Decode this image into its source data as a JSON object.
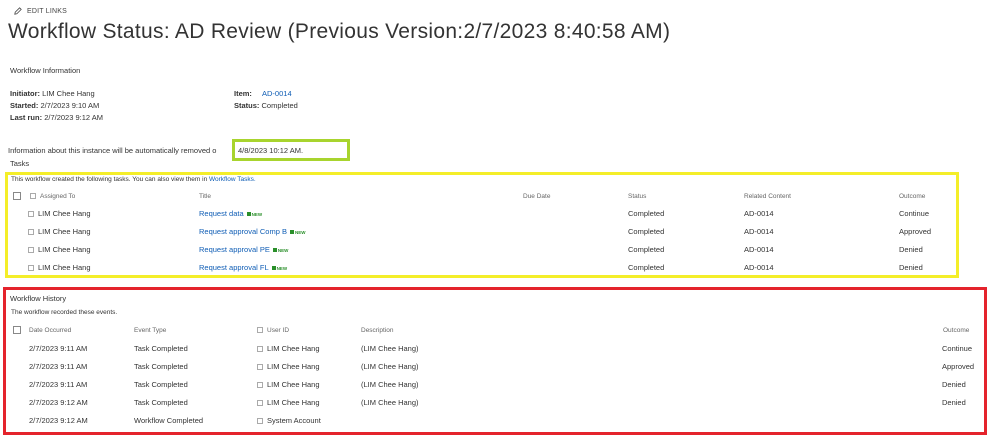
{
  "header": {
    "edit_links_label": "EDIT LINKS",
    "title": "Workflow Status: AD Review (Previous Version:2/7/2023 8:40:58 AM)"
  },
  "workflow_info": {
    "section_label": "Workflow Information",
    "initiator_label": "Initiator:",
    "initiator_value": "LIM Chee Hang",
    "started_label": "Started:",
    "started_value": "2/7/2023 9:10 AM",
    "last_run_label": "Last run:",
    "last_run_value": "2/7/2023 9:12 AM",
    "item_label": "Item:",
    "item_value": "AD-0014",
    "status_label": "Status:",
    "status_value": "Completed"
  },
  "notice": {
    "text": "Information about this instance will be automatically removed o",
    "date": "4/8/2023 10:12 AM."
  },
  "tasks": {
    "section_label": "Tasks",
    "intro": "This workflow created the following tasks. You can also view them in",
    "intro_link": "Workflow Tasks.",
    "columns": [
      "Assigned To",
      "Title",
      "Due Date",
      "Status",
      "Related Content",
      "Outcome"
    ],
    "rows": [
      {
        "assigned_to": "LIM Chee Hang",
        "title": "Request data",
        "due_date": "",
        "status": "Completed",
        "related": "AD-0014",
        "outcome": "Continue"
      },
      {
        "assigned_to": "LIM Chee Hang",
        "title": "Request approval Comp B",
        "due_date": "",
        "status": "Completed",
        "related": "AD-0014",
        "outcome": "Approved"
      },
      {
        "assigned_to": "LIM Chee Hang",
        "title": "Request approval PE",
        "due_date": "",
        "status": "Completed",
        "related": "AD-0014",
        "outcome": "Denied"
      },
      {
        "assigned_to": "LIM Chee Hang",
        "title": "Request approval FL",
        "due_date": "",
        "status": "Completed",
        "related": "AD-0014",
        "outcome": "Denied"
      }
    ],
    "new_badge": "NEW"
  },
  "history": {
    "section_label": "Workflow History",
    "intro": "The workflow recorded these events.",
    "columns": [
      "Date Occurred",
      "Event Type",
      "User ID",
      "Description",
      "Outcome"
    ],
    "rows": [
      {
        "date": "2/7/2023 9:11 AM",
        "event": "Task Completed",
        "user": "LIM Chee Hang",
        "description": "(LIM Chee Hang)",
        "outcome": "Continue"
      },
      {
        "date": "2/7/2023 9:11 AM",
        "event": "Task Completed",
        "user": "LIM Chee Hang",
        "description": "(LIM Chee Hang)",
        "outcome": "Approved"
      },
      {
        "date": "2/7/2023 9:11 AM",
        "event": "Task Completed",
        "user": "LIM Chee Hang",
        "description": "(LIM Chee Hang)",
        "outcome": "Denied"
      },
      {
        "date": "2/7/2023 9:12 AM",
        "event": "Task Completed",
        "user": "LIM Chee Hang",
        "description": "(LIM Chee Hang)",
        "outcome": "Denied"
      },
      {
        "date": "2/7/2023 9:12 AM",
        "event": "Workflow Completed",
        "user": "System Account",
        "description": "",
        "outcome": ""
      }
    ]
  },
  "highlight_colors": {
    "green": "#a8d42e",
    "yellow": "#f4ee29",
    "red": "#e4232c",
    "link": "#0f5db5"
  }
}
